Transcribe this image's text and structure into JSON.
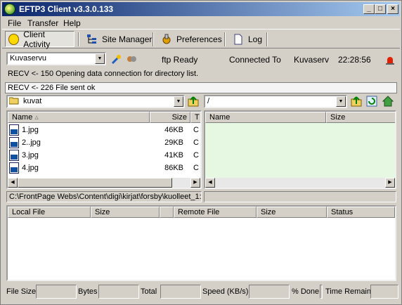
{
  "window": {
    "title": "EFTP3 Client v3.3.0.133"
  },
  "menu": {
    "file": "File",
    "transfer": "Transfer",
    "help": "Help"
  },
  "toolbar": {
    "client_activity": "Client Activity",
    "site_manager": "Site Manager",
    "preferences": "Preferences",
    "log": "Log"
  },
  "status": {
    "site": "Kuvaservu",
    "ftp_state": "ftp Ready",
    "connected_label": "Connected To",
    "connected_to": "Kuvaserv",
    "time": "22:28:56"
  },
  "log": [
    "RECV <-  150 Opening data connection for directory list.",
    "RECV <-  226 File sent ok"
  ],
  "local": {
    "folder": "kuvat",
    "columns": {
      "name": "Name",
      "size": "Size",
      "type": "T"
    },
    "files": [
      {
        "name": "1.jpg",
        "size": "46KB",
        "type": "C"
      },
      {
        "name": "2..jpg",
        "size": "29KB",
        "type": "C"
      },
      {
        "name": "3.jpg",
        "size": "41KB",
        "type": "C"
      },
      {
        "name": "4.jpg",
        "size": "86KB",
        "type": "C"
      }
    ],
    "path": "C:\\FrontPage Webs\\Content\\digi\\kirjat\\forsby\\kuolleet_1:"
  },
  "remote": {
    "folder": "/",
    "columns": {
      "name": "Name",
      "size": "Size"
    }
  },
  "queue": {
    "columns": {
      "local_file": "Local File",
      "size": "Size",
      "remote_file": "Remote File",
      "size2": "Size",
      "status": "Status"
    }
  },
  "bottom": {
    "file_size": "File Size",
    "bytes": "Bytes",
    "total": "Total",
    "speed": "Speed (KB/s)",
    "done": "% Done",
    "time_remain": "Time Remain"
  },
  "colors": {
    "remote_bg": "#e6f8e1",
    "title_start": "#0a246a"
  }
}
